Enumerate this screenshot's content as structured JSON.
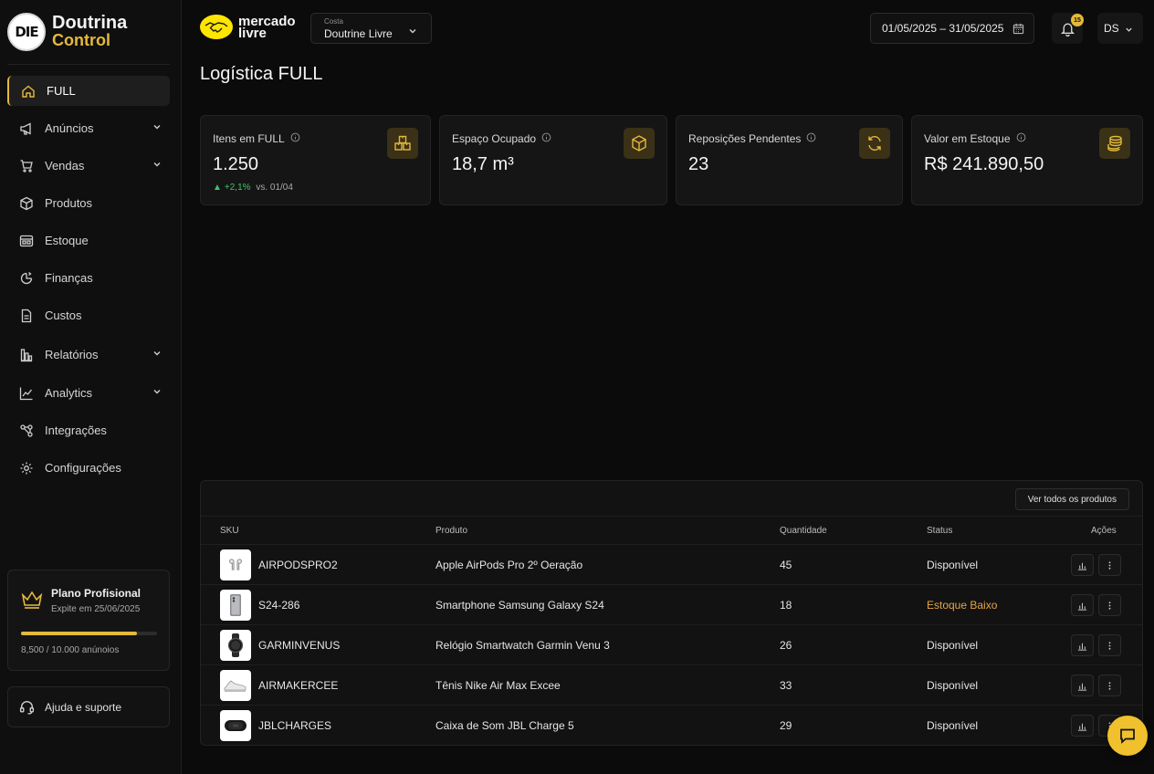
{
  "brand": {
    "logo_text": "DIE",
    "name": "Doutrina",
    "sub": "Control"
  },
  "sidebar": {
    "items": [
      {
        "label": "FULL",
        "icon": "home-icon",
        "active": true
      },
      {
        "label": "Anúncios",
        "icon": "megaphone-icon",
        "expandable": true
      },
      {
        "label": "Vendas",
        "icon": "cart-icon",
        "expandable": true
      },
      {
        "label": "Produtos",
        "icon": "box-icon"
      },
      {
        "label": "Estoque",
        "icon": "inventory-icon"
      },
      {
        "label": "Finanças",
        "icon": "finance-icon"
      },
      {
        "label": "Custos",
        "icon": "document-icon"
      },
      {
        "label": "Relatórios",
        "icon": "bar-chart-icon",
        "expandable": true
      },
      {
        "label": "Analytics",
        "icon": "line-chart-icon",
        "expandable": true
      },
      {
        "label": "Integrações",
        "icon": "integration-icon"
      },
      {
        "label": "Configurações",
        "icon": "gear-icon"
      }
    ],
    "plan": {
      "title": "Plano Profisional",
      "expires": "Expite em 25/06/2025",
      "usage_text": "8,500 / 10.000 anúnoios",
      "progress": 0.85
    },
    "help_label": "Ajuda e suporte"
  },
  "header": {
    "marketplace_logo_line1": "mercado",
    "marketplace_logo_line2": "livre",
    "account_label": "Costa",
    "account_value": "Doutrine Livre",
    "date_range": "01/05/2025 – 31/05/2025",
    "notification_count": "15",
    "user_initials": "DS"
  },
  "page_title": "Logística FULL",
  "kpis": [
    {
      "label": "Itens em FULL",
      "value": "1.250",
      "delta": "+2,1%",
      "delta_suffix": "vs. 01/04",
      "icon": "boxes-icon"
    },
    {
      "label": "Espaço Ocupado",
      "value": "18,7 m³",
      "icon": "cube-icon"
    },
    {
      "label": "Reposições Pendentes",
      "value": "23",
      "icon": "refresh-icon"
    },
    {
      "label": "Valor em Estoque",
      "value": "R$ 241.890,50",
      "icon": "coins-icon"
    }
  ],
  "table": {
    "view_all_label": "Ver todos os produtos",
    "columns": [
      "SKU",
      "Produto",
      "Quantidade",
      "Status",
      "Ações"
    ],
    "rows": [
      {
        "sku": "AIRPODSPRO2",
        "product": "Apple AirPods Pro 2º Oeração",
        "qty": "45",
        "status": "Disponível",
        "warn": false,
        "thumb": "earbuds"
      },
      {
        "sku": "S24-286",
        "product": "Smartphone Samsung Galaxy S24",
        "qty": "18",
        "status": "Estoque Baixo",
        "warn": true,
        "thumb": "phone"
      },
      {
        "sku": "GARMINVENUS",
        "product": "Relógio Smartwatch Garmin Venu 3",
        "qty": "26",
        "status": "Disponível",
        "warn": false,
        "thumb": "watch"
      },
      {
        "sku": "AIRMAKERCEE",
        "product": "Tênis Nike Air Max Excee",
        "qty": "33",
        "status": "Disponível",
        "warn": false,
        "thumb": "shoe"
      },
      {
        "sku": "JBLCHARGES",
        "product": "Caixa de Som JBL Charge 5",
        "qty": "29",
        "status": "Disponível",
        "warn": false,
        "thumb": "speaker"
      }
    ]
  },
  "colors": {
    "accent": "#e5b93a",
    "warning": "#e5a44a",
    "positive": "#3ec46d",
    "background": "#0b0b0b"
  }
}
